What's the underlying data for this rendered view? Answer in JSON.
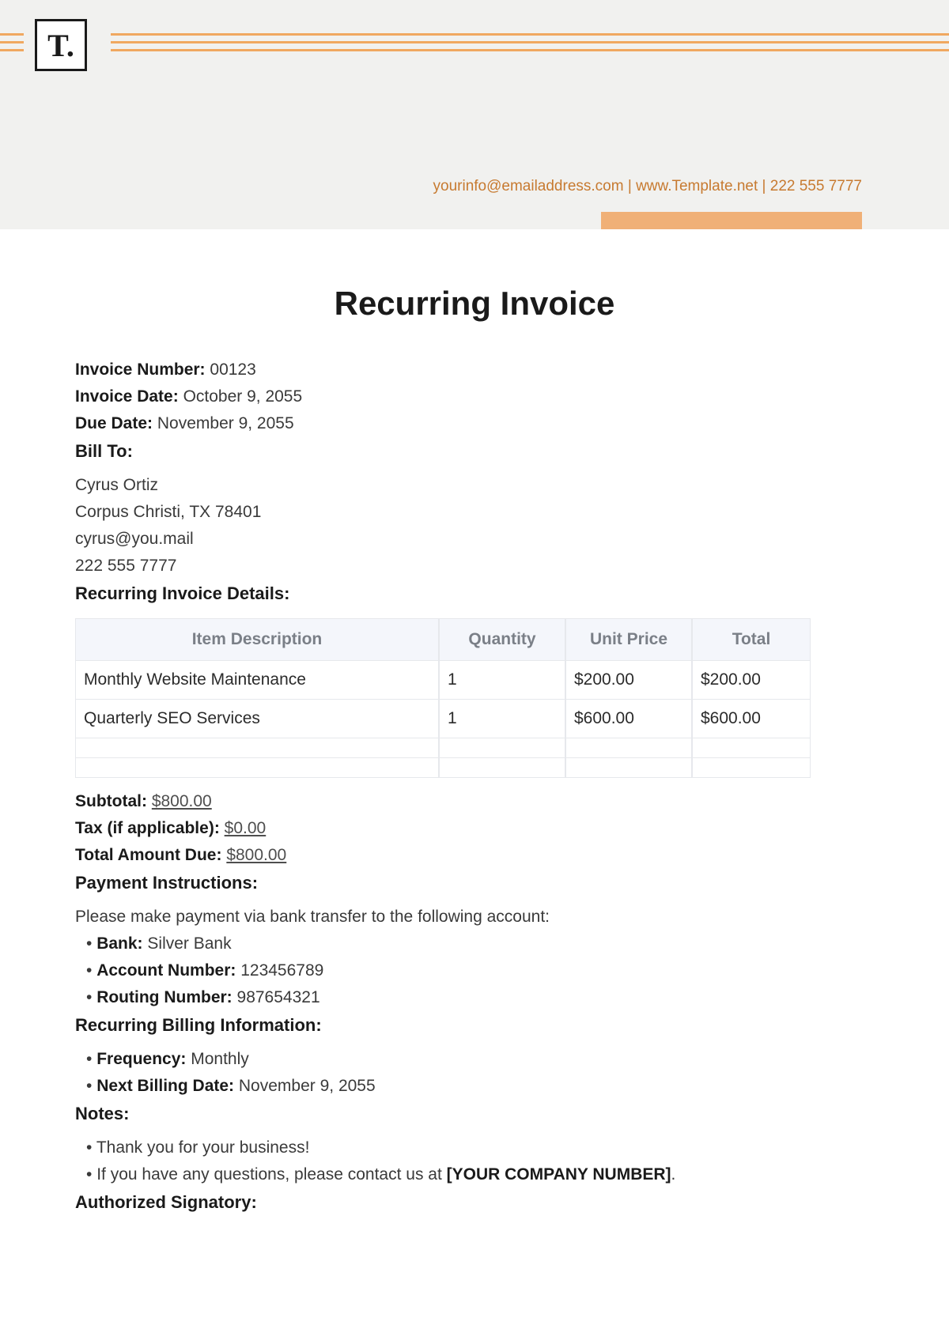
{
  "header": {
    "logo_text": "T.",
    "contact": {
      "email": "yourinfo@emailaddress.com",
      "sep1": "  |  ",
      "site": "www.Template.net",
      "sep2": "  |  ",
      "phone": "222 555 7777"
    }
  },
  "title": "Recurring Invoice",
  "meta": {
    "invoice_number_label": "Invoice Number:",
    "invoice_number": "00123",
    "invoice_date_label": "Invoice Date:",
    "invoice_date": "October 9, 2055",
    "due_date_label": "Due Date:",
    "due_date": "November 9, 2055"
  },
  "bill_to": {
    "heading": "Bill To:",
    "name": "Cyrus Ortiz",
    "address": "Corpus Christi, TX 78401",
    "email": "cyrus@you.mail",
    "phone": "222 555 7777"
  },
  "details_heading": "Recurring Invoice Details:",
  "table": {
    "headers": {
      "desc": "Item Description",
      "qty": "Quantity",
      "unit": "Unit Price",
      "total": "Total"
    },
    "rows": [
      {
        "desc": "Monthly Website Maintenance",
        "qty": "1",
        "unit": "$200.00",
        "total": "$200.00"
      },
      {
        "desc": "Quarterly SEO Services",
        "qty": "1",
        "unit": "$600.00",
        "total": "$600.00"
      }
    ]
  },
  "summary": {
    "subtotal_label": "Subtotal:",
    "subtotal": "$800.00",
    "tax_label": "Tax (if applicable):",
    "tax": "$0.00",
    "total_due_label": "Total Amount Due:",
    "total_due": "$800.00"
  },
  "payment": {
    "heading": "Payment Instructions:",
    "intro": "Please make payment via bank transfer to the following account:",
    "bank_label": "Bank:",
    "bank": "Silver Bank",
    "acct_label": "Account Number:",
    "acct": "123456789",
    "routing_label": "Routing Number:",
    "routing": "987654321"
  },
  "recurring": {
    "heading": "Recurring Billing Information:",
    "freq_label": "Frequency:",
    "freq": "Monthly",
    "next_label": "Next Billing Date:",
    "next": "November 9, 2055"
  },
  "notes": {
    "heading": "Notes:",
    "n1": "Thank you for your business!",
    "n2_a": "If you have any questions, please contact us at ",
    "n2_b": "[YOUR COMPANY NUMBER]",
    "n2_c": "."
  },
  "signatory_heading": "Authorized Signatory:"
}
